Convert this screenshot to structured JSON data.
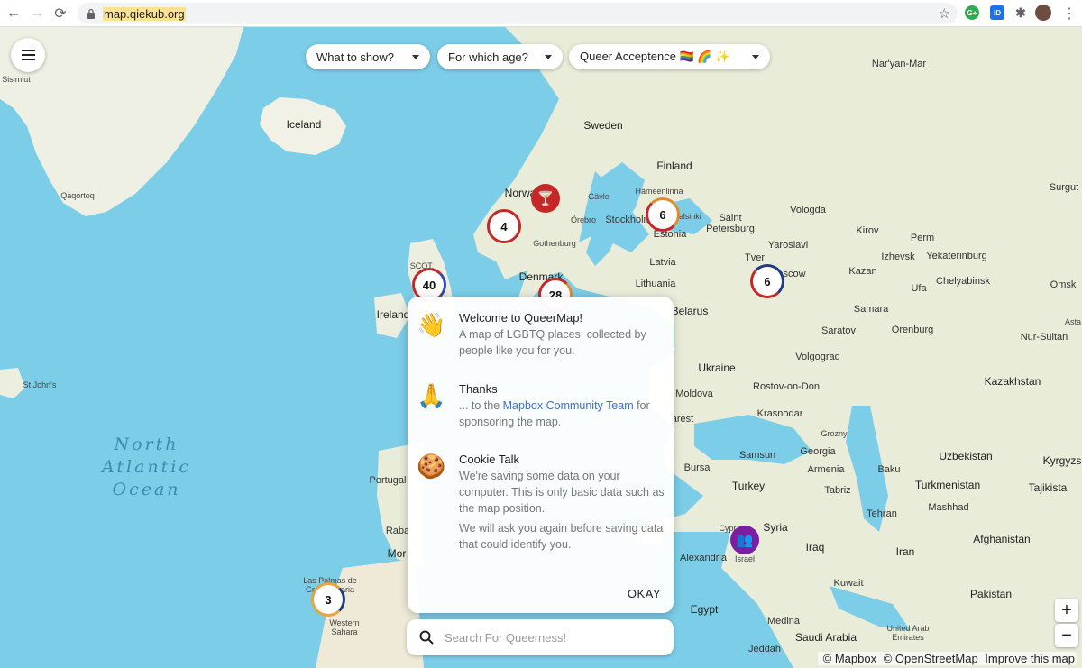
{
  "browser": {
    "url": "map.qiekub.org",
    "back_icon": "←",
    "forward_icon": "→",
    "reload_icon": "⟳",
    "star_icon": "☆",
    "menu_icon": "⋮",
    "ext1": "G+",
    "ext2": "iD"
  },
  "filters": {
    "what_to_show": "What to show?",
    "for_which_age": "For which age?",
    "preset": "Queer Acceptence 🏳️‍🌈 🌈 ✨"
  },
  "map": {
    "places": [
      {
        "id": "sisimiut",
        "label": "Sisimiut",
        "cls": "small"
      },
      {
        "id": "iceland",
        "label": "Iceland",
        "cls": "big"
      },
      {
        "id": "qaqortoq",
        "label": "Qaqortoq",
        "cls": "small"
      },
      {
        "id": "sweden",
        "label": "Sweden",
        "cls": "big"
      },
      {
        "id": "finland",
        "label": "Finland",
        "cls": "big"
      },
      {
        "id": "norway",
        "label": "Norway",
        "cls": "big"
      },
      {
        "id": "gavle",
        "label": "Gävle",
        "cls": "small"
      },
      {
        "id": "hameenlinna",
        "label": "Hämeenlinna",
        "cls": "small"
      },
      {
        "id": "orebro",
        "label": "Örebro",
        "cls": "small"
      },
      {
        "id": "stockholm",
        "label": "Stockholm",
        "cls": ""
      },
      {
        "id": "helsinki",
        "label": "Helsinki",
        "cls": "small"
      },
      {
        "id": "saint-petersburg",
        "label": "Saint\nPetersburg",
        "cls": ""
      },
      {
        "id": "estonia",
        "label": "Estonia",
        "cls": ""
      },
      {
        "id": "gothenburg",
        "label": "Gothenburg",
        "cls": "small"
      },
      {
        "id": "latvia",
        "label": "Latvia",
        "cls": ""
      },
      {
        "id": "denmark",
        "label": "Denmark",
        "cls": "big"
      },
      {
        "id": "lithuania",
        "label": "Lithuania",
        "cls": ""
      },
      {
        "id": "belarus",
        "label": "Belarus",
        "cls": "big"
      },
      {
        "id": "scotland",
        "label": "SCOT.",
        "cls": "small"
      },
      {
        "id": "ireland",
        "label": "Ireland",
        "cls": "big"
      },
      {
        "id": "ukraine",
        "label": "Ukraine",
        "cls": "big"
      },
      {
        "id": "moldova",
        "label": "Moldova",
        "cls": ""
      },
      {
        "id": "bucharest",
        "label": "arest",
        "cls": ""
      },
      {
        "id": "rostov",
        "label": "Rostov-on-Don",
        "cls": ""
      },
      {
        "id": "krasnodar",
        "label": "Krasnodar",
        "cls": ""
      },
      {
        "id": "grozny",
        "label": "Grozny",
        "cls": "small"
      },
      {
        "id": "georgia",
        "label": "Georgia",
        "cls": ""
      },
      {
        "id": "samsun",
        "label": "Samsun",
        "cls": ""
      },
      {
        "id": "armenia",
        "label": "Armenia",
        "cls": ""
      },
      {
        "id": "baku",
        "label": "Baku",
        "cls": ""
      },
      {
        "id": "bursa",
        "label": "Bursa",
        "cls": ""
      },
      {
        "id": "turkey",
        "label": "Turkey",
        "cls": "big"
      },
      {
        "id": "tabriz",
        "label": "Tabriz",
        "cls": ""
      },
      {
        "id": "tehran",
        "label": "Tehran",
        "cls": ""
      },
      {
        "id": "mashhad",
        "label": "Mashhad",
        "cls": ""
      },
      {
        "id": "syria",
        "label": "Syria",
        "cls": "big"
      },
      {
        "id": "cyprus",
        "label": "Cypr",
        "cls": "small"
      },
      {
        "id": "israel",
        "label": "Israel",
        "cls": "small"
      },
      {
        "id": "alexandria",
        "label": "Alexandria",
        "cls": ""
      },
      {
        "id": "iraq",
        "label": "Iraq",
        "cls": "big"
      },
      {
        "id": "iran",
        "label": "Iran",
        "cls": "big"
      },
      {
        "id": "kuwait",
        "label": "Kuwait",
        "cls": ""
      },
      {
        "id": "egypt",
        "label": "Egypt",
        "cls": "big"
      },
      {
        "id": "medina",
        "label": "Medina",
        "cls": ""
      },
      {
        "id": "saudi-arabia",
        "label": "Saudi Arabia",
        "cls": "big"
      },
      {
        "id": "jeddah",
        "label": "Jeddah",
        "cls": ""
      },
      {
        "id": "uae",
        "label": "United Arab\nEmirates",
        "cls": "small"
      },
      {
        "id": "pakistan",
        "label": "Pakistan",
        "cls": "big"
      },
      {
        "id": "afghanistan",
        "label": "Afghanistan",
        "cls": "big"
      },
      {
        "id": "turkmenistan",
        "label": "Turkmenistan",
        "cls": "big"
      },
      {
        "id": "uzbekistan",
        "label": "Uzbekistan",
        "cls": "big"
      },
      {
        "id": "tajikistan",
        "label": "Tajikista",
        "cls": "big"
      },
      {
        "id": "kyrgyz",
        "label": "Kyrgyzs",
        "cls": "big"
      },
      {
        "id": "kazakhstan",
        "label": "Kazakhstan",
        "cls": "big"
      },
      {
        "id": "astana",
        "label": "Asta",
        "cls": "small"
      },
      {
        "id": "nur-sultan",
        "label": "Nur-Sultan",
        "cls": ""
      },
      {
        "id": "omsk",
        "label": "Omsk",
        "cls": ""
      },
      {
        "id": "chelyabinsk",
        "label": "Chelyabinsk",
        "cls": ""
      },
      {
        "id": "ufa",
        "label": "Ufa",
        "cls": ""
      },
      {
        "id": "samara",
        "label": "Samara",
        "cls": ""
      },
      {
        "id": "orenburg",
        "label": "Orenburg",
        "cls": ""
      },
      {
        "id": "saratov",
        "label": "Saratov",
        "cls": ""
      },
      {
        "id": "volgograd",
        "label": "Volgograd",
        "cls": ""
      },
      {
        "id": "kazan",
        "label": "Kazan",
        "cls": ""
      },
      {
        "id": "izhevsk",
        "label": "Izhevsk",
        "cls": ""
      },
      {
        "id": "perm",
        "label": "Perm",
        "cls": ""
      },
      {
        "id": "yekaterinburg",
        "label": "Yekaterinburg",
        "cls": ""
      },
      {
        "id": "kirov",
        "label": "Kirov",
        "cls": ""
      },
      {
        "id": "yaroslavl",
        "label": "Yaroslavl",
        "cls": ""
      },
      {
        "id": "tver",
        "label": "Tver",
        "cls": ""
      },
      {
        "id": "moscow",
        "label": "oscow",
        "cls": ""
      },
      {
        "id": "vologda",
        "label": "Vologda",
        "cls": ""
      },
      {
        "id": "naryan-mar",
        "label": "Nar'yan-Mar",
        "cls": ""
      },
      {
        "id": "surgut",
        "label": "Surgut",
        "cls": ""
      },
      {
        "id": "st-johns",
        "label": "St John's",
        "cls": "small"
      },
      {
        "id": "portugal",
        "label": "Portugal",
        "cls": ""
      },
      {
        "id": "rabat",
        "label": "Raba",
        "cls": ""
      },
      {
        "id": "morocco",
        "label": "Mor",
        "cls": "big"
      },
      {
        "id": "las-palmas",
        "label": "Las Palmas de\nGran Canaria",
        "cls": "small"
      },
      {
        "id": "western-sahara",
        "label": "Western\nSahara",
        "cls": "small"
      }
    ],
    "ocean_label": "North\nAtlantic\nOcean",
    "clusters": [
      {
        "id": "norway-cluster",
        "count": "4",
        "ring": "#c62828"
      },
      {
        "id": "finland-cluster",
        "count": "6",
        "ring": "#e28c2b"
      },
      {
        "id": "moscow-cluster",
        "count": "6",
        "ring": "#c62828"
      },
      {
        "id": "uk-cluster",
        "count": "40",
        "ring": "#c62828"
      },
      {
        "id": "denmark-cluster",
        "count": "28",
        "ring": "#e28c2b"
      },
      {
        "id": "canary-cluster",
        "count": "3",
        "ring": "#e8a33a"
      }
    ],
    "pins": [
      {
        "id": "bar-pin",
        "icon": "🍸",
        "color": "#c62828"
      },
      {
        "id": "community-pin",
        "icon": "👥",
        "color": "#7b1fa2"
      }
    ]
  },
  "welcome": {
    "items": [
      {
        "emoji": "👋",
        "title": "Welcome to QueerMap!",
        "text": "A map of LGBTQ places, collected by people like you for you."
      },
      {
        "emoji": "🙏",
        "title": "Thanks",
        "text_before": "... to the ",
        "link": "Mapbox Community Team",
        "text_after": " for sponsoring the map."
      },
      {
        "emoji": "🍪",
        "title": "Cookie Talk",
        "text": "We're saving some data on your computer. This is only basic data such as the map position.",
        "text2": "We will ask you again before saving data that could identify you."
      }
    ],
    "ok": "OKAY"
  },
  "search": {
    "placeholder": "Search For Queerness!",
    "icon": "search-icon"
  },
  "zoom": {
    "in": "+",
    "out": "−"
  },
  "attribution": {
    "mapbox": "© Mapbox",
    "osm": "© OpenStreetMap",
    "improve": "Improve this map"
  }
}
